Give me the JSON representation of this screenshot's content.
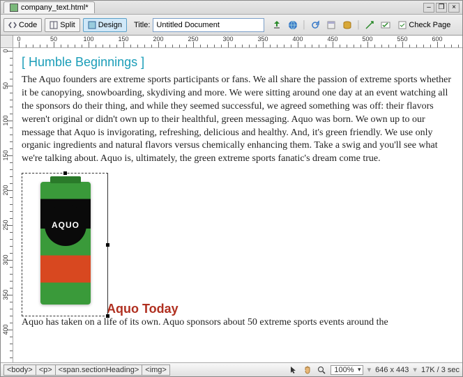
{
  "tab": {
    "filename": "company_text.html*"
  },
  "toolbar": {
    "code": "Code",
    "split": "Split",
    "design": "Design",
    "titleLabel": "Title:",
    "titleValue": "Untitled Document",
    "checkPage": "Check Page"
  },
  "ruler": {
    "units": [
      0,
      50,
      100,
      150,
      200,
      250,
      300,
      350,
      400,
      450,
      500,
      550,
      600
    ]
  },
  "content": {
    "h1_open": "[ ",
    "h1_text": "Humble Beginnings",
    "h1_close": " ]",
    "p1": "The Aquo founders are extreme sports participants or fans. We all share the passion of extreme sports whether it be canopying, snowboarding, skydiving and more. We were sitting around one day at an event watching all the sponsors do their thing, and while they seemed successful, we agreed something was off: their flavors weren't original or didn't own up to their healthful, green messaging. Aquo was born. We own up to our message that Aquo is invigorating, refreshing, delicious and healthy. And, it's green friendly. We use only organic ingredients and natural flavors versus chemically enhancing them. Take a swig and you'll see what we're talking about. Aquo is, ultimately, the green extreme sports fanatic's dream come true.",
    "product_logo": "AQUO",
    "h2": "Aquo Today",
    "p2": "Aquo has taken on a life of its own. Aquo sponsors about 50 extreme sports events around the"
  },
  "status": {
    "tags": [
      "<body>",
      "<p>",
      "<span.sectionHeading>",
      "<img>"
    ],
    "zoom": "100%",
    "dims": "646 x 443",
    "filesize": "17K / 3 sec"
  }
}
